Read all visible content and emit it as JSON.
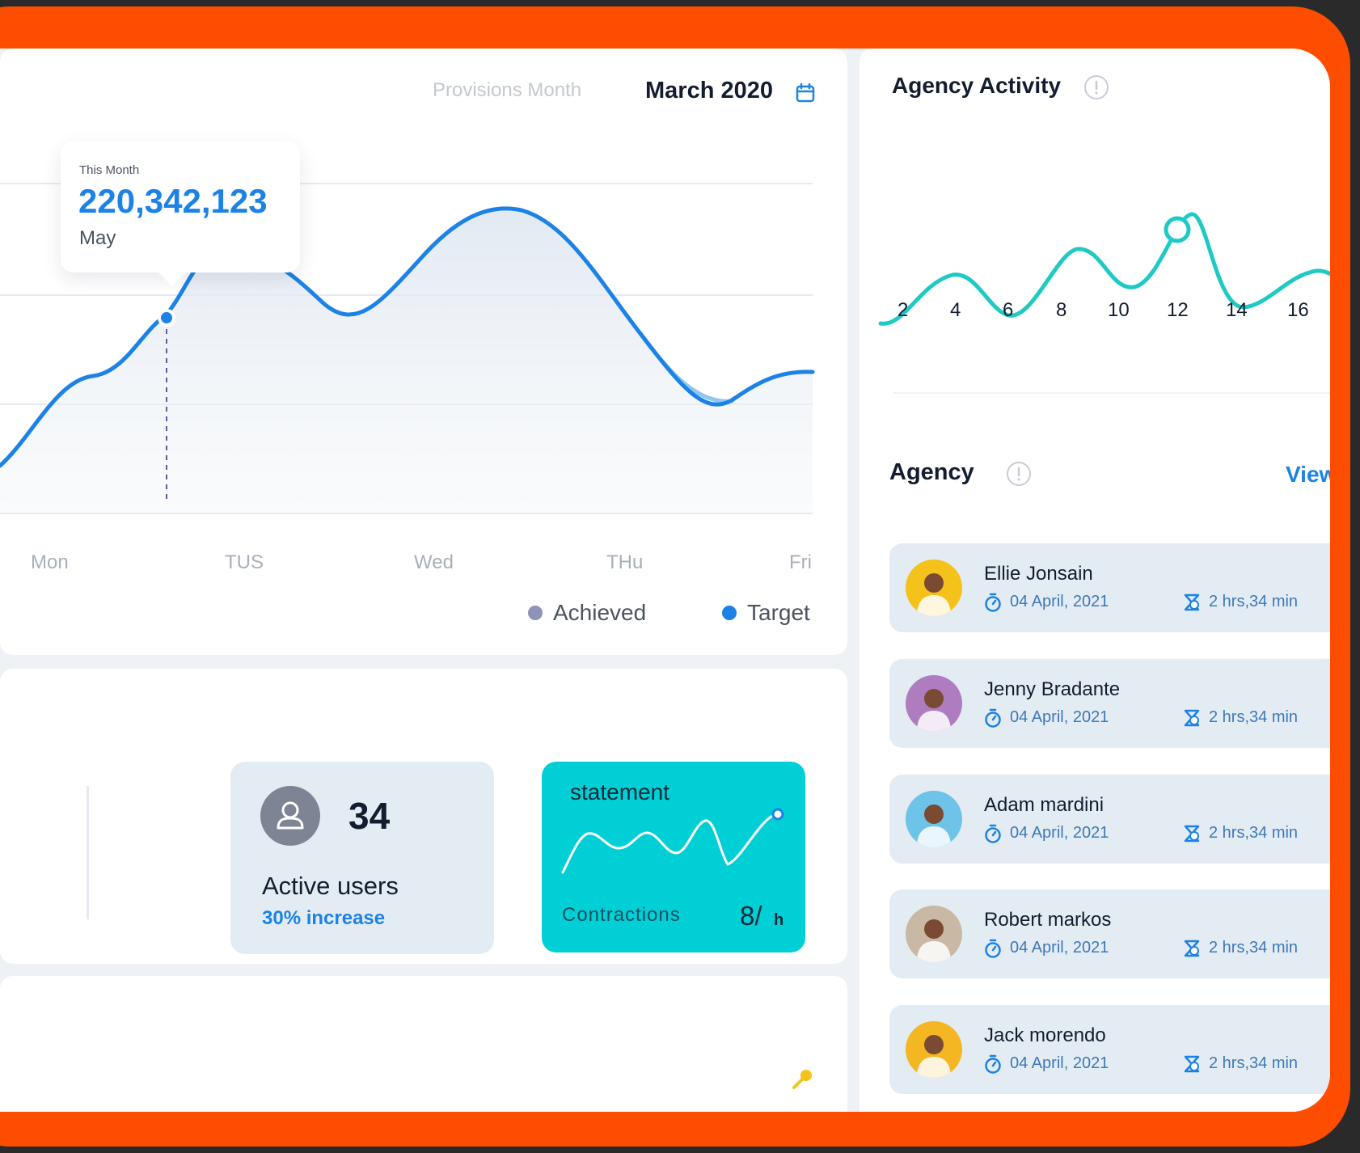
{
  "main_chart": {
    "provisions_label": "Provisions Month",
    "month_value": "March 2020",
    "tooltip": {
      "label": "This Month",
      "value": "220,342,123",
      "month": "May"
    },
    "days": [
      "Mon",
      "TUS",
      "Wed",
      "THu",
      "Fri"
    ],
    "legend": [
      {
        "label": "Achieved",
        "color": "#8f93b8"
      },
      {
        "label": "Target",
        "color": "#1c82e6"
      }
    ]
  },
  "stats": {
    "active_users": {
      "count": "34",
      "label": "Active users",
      "change": "30% increase"
    },
    "statement": {
      "title": "statement",
      "metric_label": "Contractions",
      "metric_value": "8/",
      "metric_unit": "h"
    }
  },
  "agency_activity": {
    "title": "Agency Activity",
    "x_ticks": [
      "2",
      "4",
      "6",
      "8",
      "10",
      "12",
      "14",
      "16"
    ]
  },
  "agency": {
    "title": "Agency",
    "view_label": "View",
    "items": [
      {
        "name": "Ellie Jonsain",
        "date": "04 April, 2021",
        "duration": "2 hrs,34 min",
        "avatar_color": "#f4c21b"
      },
      {
        "name": "Jenny Bradante",
        "date": "04 April, 2021",
        "duration": "2 hrs,34 min",
        "avatar_color": "#b07cc0"
      },
      {
        "name": "Adam mardini",
        "date": "04 April, 2021",
        "duration": "2 hrs,34 min",
        "avatar_color": "#6ec3e8"
      },
      {
        "name": "Robert markos",
        "date": "04 April, 2021",
        "duration": "2 hrs,34 min",
        "avatar_color": "#c9b8a3"
      },
      {
        "name": "Jack morendo",
        "date": "04 April, 2021",
        "duration": "2 hrs,34 min",
        "avatar_color": "#f4b622"
      }
    ]
  },
  "colors": {
    "brand": "#ff4d00",
    "accent": "#1c82e6",
    "teal": "#00cfd6",
    "activity_line": "#1fc9c4"
  }
}
